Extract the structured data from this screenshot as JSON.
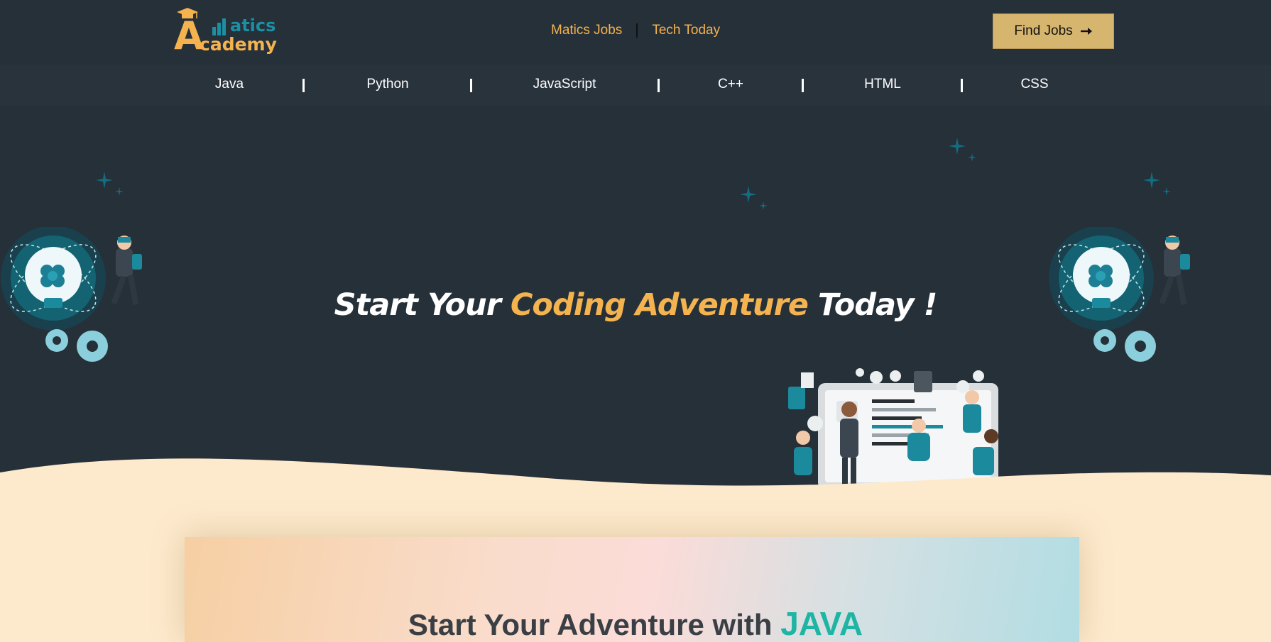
{
  "header": {
    "logo": {
      "top_word": "atics",
      "bottom_word": "cademy",
      "letter": "A",
      "alt": "Matics Academy"
    },
    "nav_links": [
      {
        "label": "Matics Jobs"
      },
      {
        "label": "Tech Today"
      }
    ],
    "cta_label": "Find Jobs",
    "cta_icon": "arrow-right-icon"
  },
  "language_nav": {
    "items": [
      {
        "label": "Java"
      },
      {
        "label": "Python"
      },
      {
        "label": "JavaScript"
      },
      {
        "label": "C++"
      },
      {
        "label": "HTML"
      },
      {
        "label": "CSS"
      }
    ]
  },
  "hero": {
    "title_start": "Start Your ",
    "title_accent": "Coding Adventure",
    "title_end": " Today !"
  },
  "section": {
    "title_start": "Start Your Adventure with ",
    "title_accent": "JAVA"
  },
  "colors": {
    "background": "#263039",
    "accent": "#f4b34f",
    "button": "#d6b56e",
    "sand": "#fde9cc",
    "teal": "#1eb5a4"
  }
}
